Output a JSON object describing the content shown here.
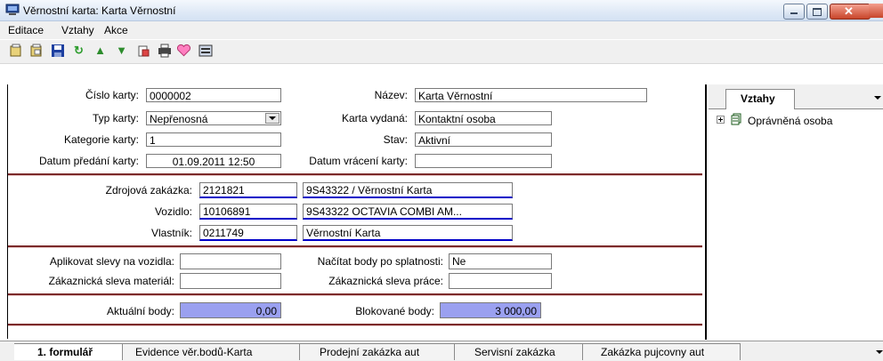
{
  "window": {
    "title": "Věrnostní karta: Karta Věrnostní"
  },
  "menu": [
    "Editace",
    "Vztahy",
    "Akce"
  ],
  "toolbar_icons": [
    "new-icon",
    "copy-icon",
    "save-icon",
    "refresh-icon",
    "move-up-icon",
    "move-down-icon",
    "paste-icon",
    "print-icon",
    "heart-icon",
    "form-icon"
  ],
  "form": {
    "cislo_karty": {
      "label": "Číslo karty:",
      "value": "0000002"
    },
    "nazev": {
      "label": "Název:",
      "value": "Karta Věrnostní"
    },
    "typ_karty": {
      "label": "Typ karty:",
      "value": "Nepřenosná"
    },
    "karta_vydana": {
      "label": "Karta vydaná:",
      "value": "Kontaktní osoba"
    },
    "kategorie_karty": {
      "label": "Kategorie karty:",
      "value": "1"
    },
    "stav": {
      "label": "Stav:",
      "value": "Aktivní"
    },
    "datum_predani": {
      "label": "Datum předání karty:",
      "value": "01.09.2011 12:50"
    },
    "datum_vraceni": {
      "label": "Datum vrácení karty:",
      "value": ""
    },
    "zdrojova_zakazka": {
      "label": "Zdrojová zakázka:",
      "code": "2121821",
      "desc": "9S43322 / Věrnostní Karta"
    },
    "vozidlo": {
      "label": "Vozidlo:",
      "code": "10106891",
      "desc": "9S43322 OCTAVIA COMBI AM..."
    },
    "vlastnik": {
      "label": "Vlastník:",
      "code": "0211749",
      "desc": "Věrnostní Karta"
    },
    "aplikovat_slevy": {
      "label": "Aplikovat slevy na vozidla:",
      "value": ""
    },
    "nacitat_body": {
      "label": "Načítat body po splatnosti:",
      "value": "Ne"
    },
    "sleva_material": {
      "label": "Zákaznická sleva materiál:",
      "value": ""
    },
    "sleva_prace": {
      "label": "Zákaznická sleva práce:",
      "value": ""
    },
    "aktualni_body": {
      "label": "Aktuální body:",
      "value": "0,00"
    },
    "blokovane_body": {
      "label": "Blokované body:",
      "value": "3 000,00"
    }
  },
  "right_pane": {
    "tab": "Vztahy",
    "tree_items": [
      "Oprávněná osoba"
    ]
  },
  "tabs": [
    "1. formulář",
    "Evidence věr.bodů-Karta",
    "Prodejní zakázka aut",
    "Servisní zakázka",
    "Zakázka pujcovny aut"
  ]
}
